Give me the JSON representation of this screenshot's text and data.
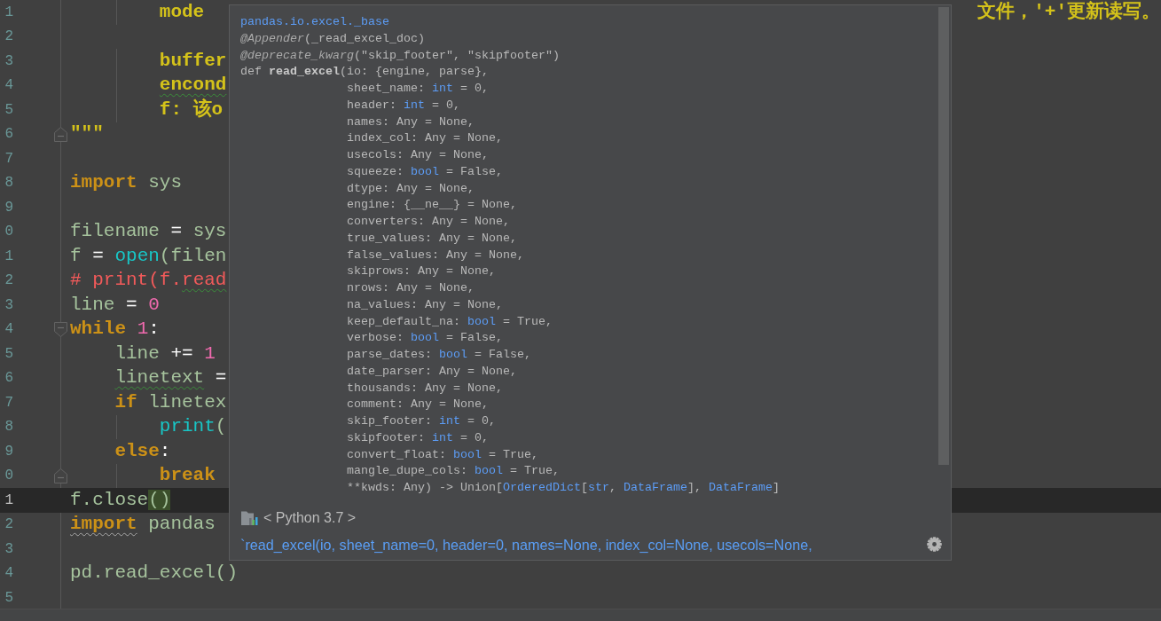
{
  "editor": {
    "lines": [
      {
        "number": "1",
        "current": false,
        "kind": "plain",
        "tokens": [
          {
            "text": "        mode",
            "kind": "docstring",
            "squiggle": false,
            "brace_match": false
          }
        ],
        "tail": [
          {
            "text": "文件，'+'更新读写。",
            "kind": "docstring"
          }
        ]
      },
      {
        "number": "2",
        "current": false,
        "kind": "plain"
      },
      {
        "number": "3",
        "current": false,
        "kind": "plain",
        "tokens": [
          {
            "text": "        buffer",
            "kind": "docstring",
            "squiggle": false,
            "brace_match": false
          }
        ]
      },
      {
        "number": "4",
        "current": false,
        "kind": "plain",
        "tokens": [
          {
            "text": "        encond",
            "kind": "docstring",
            "squiggle": true,
            "brace_match": false
          }
        ]
      },
      {
        "number": "5",
        "current": false,
        "kind": "plain",
        "tokens": [
          {
            "text": "        f: 该o",
            "kind": "docstring",
            "squiggle": false,
            "brace_match": false
          }
        ]
      },
      {
        "number": "6",
        "current": false,
        "kind": "fold_end",
        "tokens": [
          {
            "text": "\"\"\"",
            "kind": "docstring",
            "squiggle": false,
            "brace_match": false
          }
        ]
      },
      {
        "number": "7",
        "current": false,
        "kind": "plain"
      },
      {
        "number": "8",
        "current": false,
        "kind": "plain",
        "tokens": [
          {
            "text": "import",
            "kind": "keyword",
            "squiggle": false,
            "brace_match": false
          },
          {
            "text": " sys",
            "kind": "name",
            "squiggle": false,
            "brace_match": false
          }
        ]
      },
      {
        "number": "9",
        "current": false,
        "kind": "plain"
      },
      {
        "number": "0",
        "current": false,
        "kind": "plain",
        "tokens": [
          {
            "text": "filename",
            "kind": "name",
            "squiggle": false,
            "brace_match": false
          },
          {
            "text": " = ",
            "kind": "operator",
            "squiggle": false,
            "brace_match": false
          },
          {
            "text": "sys",
            "kind": "name",
            "squiggle": false,
            "brace_match": false
          }
        ]
      },
      {
        "number": "1",
        "current": false,
        "kind": "plain",
        "tokens": [
          {
            "text": "f",
            "kind": "name",
            "squiggle": false,
            "brace_match": false
          },
          {
            "text": " = ",
            "kind": "operator",
            "squiggle": false,
            "brace_match": false
          },
          {
            "text": "open",
            "kind": "builtin",
            "squiggle": false,
            "brace_match": false
          },
          {
            "text": "(filen",
            "kind": "name",
            "squiggle": false,
            "brace_match": false
          }
        ]
      },
      {
        "number": "2",
        "current": false,
        "kind": "plain",
        "tokens": [
          {
            "text": "# print(f.",
            "kind": "comment",
            "squiggle": false,
            "brace_match": false
          },
          {
            "text": "read",
            "kind": "comment",
            "squiggle": true,
            "brace_match": false
          }
        ]
      },
      {
        "number": "3",
        "current": false,
        "kind": "plain",
        "tokens": [
          {
            "text": "line",
            "kind": "name",
            "squiggle": false,
            "brace_match": false
          },
          {
            "text": " = ",
            "kind": "operator",
            "squiggle": false,
            "brace_match": false
          },
          {
            "text": "0",
            "kind": "number",
            "squiggle": false,
            "brace_match": false
          }
        ]
      },
      {
        "number": "4",
        "current": false,
        "kind": "fold_start",
        "tokens": [
          {
            "text": "while ",
            "kind": "keyword",
            "squiggle": false,
            "brace_match": false
          },
          {
            "text": "1",
            "kind": "number",
            "squiggle": false,
            "brace_match": false
          },
          {
            "text": ":",
            "kind": "operator",
            "squiggle": false,
            "brace_match": false
          }
        ]
      },
      {
        "number": "5",
        "current": false,
        "kind": "plain",
        "tokens": [
          {
            "text": "    line",
            "kind": "name",
            "squiggle": false,
            "brace_match": false
          },
          {
            "text": " += ",
            "kind": "operator",
            "squiggle": false,
            "brace_match": false
          },
          {
            "text": "1",
            "kind": "number",
            "squiggle": false,
            "brace_match": false
          }
        ]
      },
      {
        "number": "6",
        "current": false,
        "kind": "plain",
        "tokens": [
          {
            "text": "    linetext",
            "kind": "name",
            "squiggle": true,
            "brace_match": false
          },
          {
            "text": " =",
            "kind": "operator",
            "squiggle": false,
            "brace_match": false
          }
        ]
      },
      {
        "number": "7",
        "current": false,
        "kind": "plain",
        "tokens": [
          {
            "text": "    if ",
            "kind": "keyword",
            "squiggle": false,
            "brace_match": false
          },
          {
            "text": "linetex",
            "kind": "name",
            "squiggle": false,
            "brace_match": false
          }
        ]
      },
      {
        "number": "8",
        "current": false,
        "kind": "plain",
        "tokens": [
          {
            "text": "        print",
            "kind": "builtin",
            "squiggle": false,
            "brace_match": false
          },
          {
            "text": "(",
            "kind": "name",
            "squiggle": false,
            "brace_match": false
          }
        ]
      },
      {
        "number": "9",
        "current": false,
        "kind": "plain",
        "tokens": [
          {
            "text": "    else",
            "kind": "keyword",
            "squiggle": false,
            "brace_match": false
          },
          {
            "text": ":",
            "kind": "operator",
            "squiggle": false,
            "brace_match": false
          }
        ]
      },
      {
        "number": "0",
        "current": false,
        "kind": "fold_end",
        "tokens": [
          {
            "text": "        break",
            "kind": "keyword",
            "squiggle": false,
            "brace_match": false
          }
        ]
      },
      {
        "number": "1",
        "current": true,
        "kind": "plain",
        "tokens": [
          {
            "text": "f.close",
            "kind": "name",
            "squiggle": false,
            "brace_match": false
          },
          {
            "text": "()",
            "kind": "name",
            "squiggle": false,
            "brace_match": true
          }
        ]
      },
      {
        "number": "2",
        "current": false,
        "kind": "plain",
        "tokens": [
          {
            "text": "import",
            "kind": "keyword",
            "squiggle": true,
            "brace_match": false
          },
          {
            "text": " pandas",
            "kind": "name",
            "squiggle": false,
            "brace_match": false
          }
        ]
      },
      {
        "number": "3",
        "current": false,
        "kind": "plain"
      },
      {
        "number": "4",
        "current": false,
        "kind": "plain",
        "tokens": [
          {
            "text": "pd.read_excel()",
            "kind": "name",
            "squiggle": false,
            "brace_match": false
          }
        ]
      },
      {
        "number": "5",
        "current": false,
        "kind": "plain"
      }
    ]
  },
  "popup": {
    "doc_lines": [
      [
        {
          "text": "pandas.io.excel._base",
          "kind": "module"
        }
      ],
      [
        {
          "text": "@Appender",
          "kind": "decorator"
        },
        {
          "text": "(_read_excel_doc)",
          "kind": "plain"
        }
      ],
      [
        {
          "text": "@deprecate_kwarg",
          "kind": "decorator"
        },
        {
          "text": "(\"skip_footer\", \"skipfooter\")",
          "kind": "plain"
        }
      ],
      [
        {
          "text": "def ",
          "kind": "plain"
        },
        {
          "text": "read_excel",
          "kind": "function"
        },
        {
          "text": "(io: {engine, parse},",
          "kind": "plain"
        }
      ],
      [
        {
          "text": "               sheet_name: ",
          "kind": "plain"
        },
        {
          "text": "int",
          "kind": "type"
        },
        {
          "text": " = 0,",
          "kind": "plain"
        }
      ],
      [
        {
          "text": "               header: ",
          "kind": "plain"
        },
        {
          "text": "int",
          "kind": "type"
        },
        {
          "text": " = 0,",
          "kind": "plain"
        }
      ],
      [
        {
          "text": "               names: Any = None,",
          "kind": "plain"
        }
      ],
      [
        {
          "text": "               index_col: Any = None,",
          "kind": "plain"
        }
      ],
      [
        {
          "text": "               usecols: Any = None,",
          "kind": "plain"
        }
      ],
      [
        {
          "text": "               squeeze: ",
          "kind": "plain"
        },
        {
          "text": "bool",
          "kind": "type"
        },
        {
          "text": " = False,",
          "kind": "plain"
        }
      ],
      [
        {
          "text": "               dtype: Any = None,",
          "kind": "plain"
        }
      ],
      [
        {
          "text": "               engine: {__ne__} = None,",
          "kind": "plain"
        }
      ],
      [
        {
          "text": "               converters: Any = None,",
          "kind": "plain"
        }
      ],
      [
        {
          "text": "               true_values: Any = None,",
          "kind": "plain"
        }
      ],
      [
        {
          "text": "               false_values: Any = None,",
          "kind": "plain"
        }
      ],
      [
        {
          "text": "               skiprows: Any = None,",
          "kind": "plain"
        }
      ],
      [
        {
          "text": "               nrows: Any = None,",
          "kind": "plain"
        }
      ],
      [
        {
          "text": "               na_values: Any = None,",
          "kind": "plain"
        }
      ],
      [
        {
          "text": "               keep_default_na: ",
          "kind": "plain"
        },
        {
          "text": "bool",
          "kind": "type"
        },
        {
          "text": " = True,",
          "kind": "plain"
        }
      ],
      [
        {
          "text": "               verbose: ",
          "kind": "plain"
        },
        {
          "text": "bool",
          "kind": "type"
        },
        {
          "text": " = False,",
          "kind": "plain"
        }
      ],
      [
        {
          "text": "               parse_dates: ",
          "kind": "plain"
        },
        {
          "text": "bool",
          "kind": "type"
        },
        {
          "text": " = False,",
          "kind": "plain"
        }
      ],
      [
        {
          "text": "               date_parser: Any = None,",
          "kind": "plain"
        }
      ],
      [
        {
          "text": "               thousands: Any = None,",
          "kind": "plain"
        }
      ],
      [
        {
          "text": "               comment: Any = None,",
          "kind": "plain"
        }
      ],
      [
        {
          "text": "               skip_footer: ",
          "kind": "plain"
        },
        {
          "text": "int",
          "kind": "type"
        },
        {
          "text": " = 0,",
          "kind": "plain"
        }
      ],
      [
        {
          "text": "               skipfooter: ",
          "kind": "plain"
        },
        {
          "text": "int",
          "kind": "type"
        },
        {
          "text": " = 0,",
          "kind": "plain"
        }
      ],
      [
        {
          "text": "               convert_float: ",
          "kind": "plain"
        },
        {
          "text": "bool",
          "kind": "type"
        },
        {
          "text": " = True,",
          "kind": "plain"
        }
      ],
      [
        {
          "text": "               mangle_dupe_cols: ",
          "kind": "plain"
        },
        {
          "text": "bool",
          "kind": "type"
        },
        {
          "text": " = True,",
          "kind": "plain"
        }
      ],
      [
        {
          "text": "               **kwds: Any) -> Union[",
          "kind": "plain"
        },
        {
          "text": "OrderedDict",
          "kind": "type"
        },
        {
          "text": "[",
          "kind": "plain"
        },
        {
          "text": "str",
          "kind": "type"
        },
        {
          "text": ", ",
          "kind": "plain"
        },
        {
          "text": "DataFrame",
          "kind": "type"
        },
        {
          "text": "], ",
          "kind": "plain"
        },
        {
          "text": "DataFrame",
          "kind": "type"
        },
        {
          "text": "]",
          "kind": "plain"
        }
      ]
    ],
    "sdk_label": "< Python 3.7 >",
    "description": "`read_excel(io, sheet_name=0, header=0, names=None, index_col=None, usecols=None,"
  }
}
